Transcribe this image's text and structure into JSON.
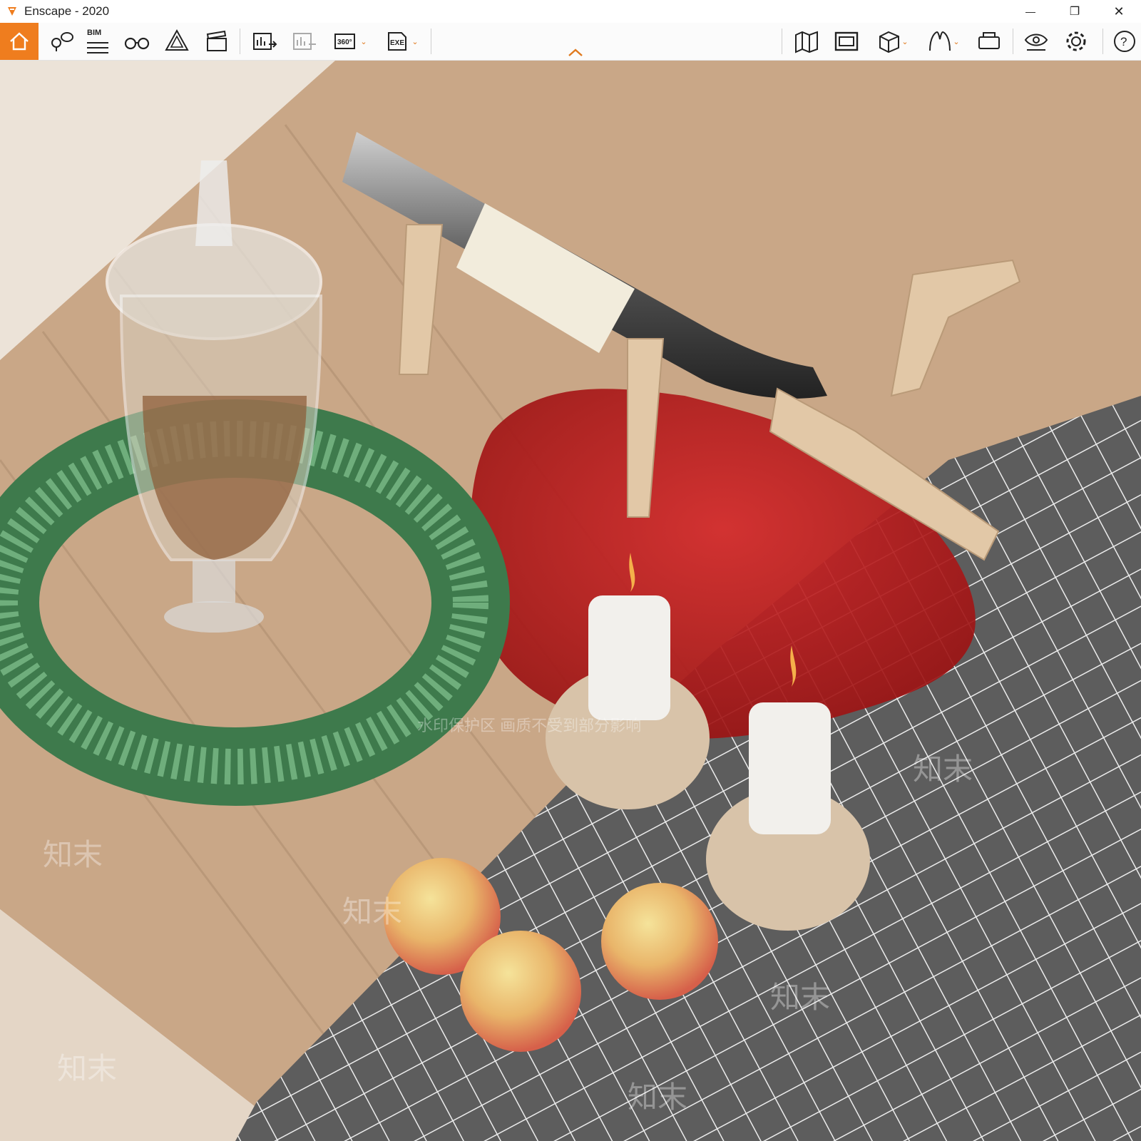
{
  "window": {
    "title": "Enscape - 2020",
    "controls": {
      "minimize": "—",
      "restore": "❐",
      "close": "✕"
    }
  },
  "toolbar": {
    "bim_label": "BIM",
    "btn_360_label": "360°",
    "btn_exe_label": "EXE",
    "accent_color": "#ef7d1e",
    "items": [
      {
        "icon": "home-icon"
      },
      {
        "icon": "location-views-icon"
      },
      {
        "icon": "bim-info-icon"
      },
      {
        "icon": "binoculars-icon"
      },
      {
        "icon": "atmosphere-icon"
      },
      {
        "icon": "video-editor-icon"
      },
      {
        "icon": "render-image-icon"
      },
      {
        "icon": "batch-render-icon"
      },
      {
        "icon": "panorama-360-icon"
      },
      {
        "icon": "export-exe-icon"
      },
      {
        "icon": "map-icon"
      },
      {
        "icon": "asset-library-icon"
      },
      {
        "icon": "box-view-icon"
      },
      {
        "icon": "vr-headset-icon"
      },
      {
        "icon": "view-settings-icon"
      },
      {
        "icon": "settings-icon"
      },
      {
        "icon": "help-icon"
      }
    ]
  },
  "viewport": {
    "watermark_text": "知末",
    "watermark_note": "水印保护区  画质不受到部分影响",
    "scene_colors": {
      "table": "#c9a787",
      "wine": "#b51d1d",
      "cloth": "#5d5d5d",
      "wreath": "#4f8a5c"
    }
  }
}
